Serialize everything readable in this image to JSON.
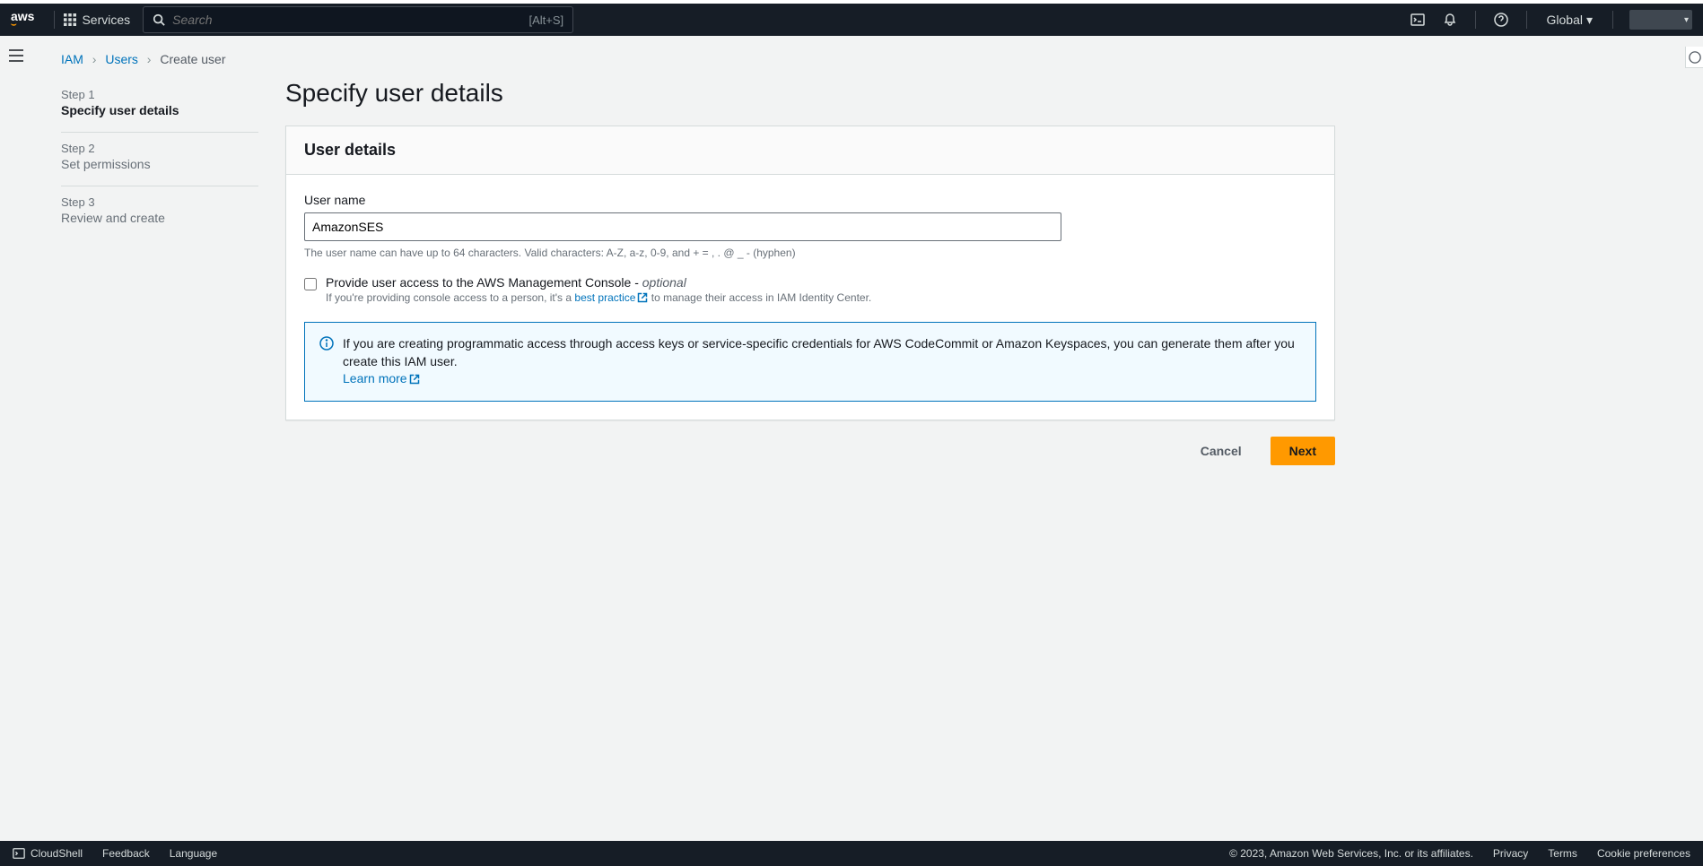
{
  "nav": {
    "logo_text": "aws",
    "services_label": "Services",
    "search_placeholder": "Search",
    "search_shortcut": "[Alt+S]",
    "region": "Global"
  },
  "breadcrumb": {
    "items": [
      "IAM",
      "Users",
      "Create user"
    ]
  },
  "steps": [
    {
      "num": "Step 1",
      "label": "Specify user details",
      "active": true
    },
    {
      "num": "Step 2",
      "label": "Set permissions",
      "active": false
    },
    {
      "num": "Step 3",
      "label": "Review and create",
      "active": false
    }
  ],
  "page": {
    "title": "Specify user details",
    "panel_title": "User details",
    "username_label": "User name",
    "username_value": "AmazonSES",
    "username_hint": "The user name can have up to 64 characters. Valid characters: A-Z, a-z, 0-9, and + = , . @ _ - (hyphen)",
    "console_access_label": "Provide user access to the AWS Management Console - ",
    "console_access_optional": "optional",
    "console_access_desc_pre": "If you're providing console access to a person, it's a ",
    "console_access_link": "best practice",
    "console_access_desc_post": " to manage their access in IAM Identity Center.",
    "info_text": "If you are creating programmatic access through access keys or service-specific credentials for AWS CodeCommit or Amazon Keyspaces, you can generate them after you create this IAM user.",
    "info_link": "Learn more",
    "cancel_label": "Cancel",
    "next_label": "Next"
  },
  "footer": {
    "cloudshell": "CloudShell",
    "feedback": "Feedback",
    "language": "Language",
    "copyright": "© 2023, Amazon Web Services, Inc. or its affiliates.",
    "privacy": "Privacy",
    "terms": "Terms",
    "cookies": "Cookie preferences"
  }
}
